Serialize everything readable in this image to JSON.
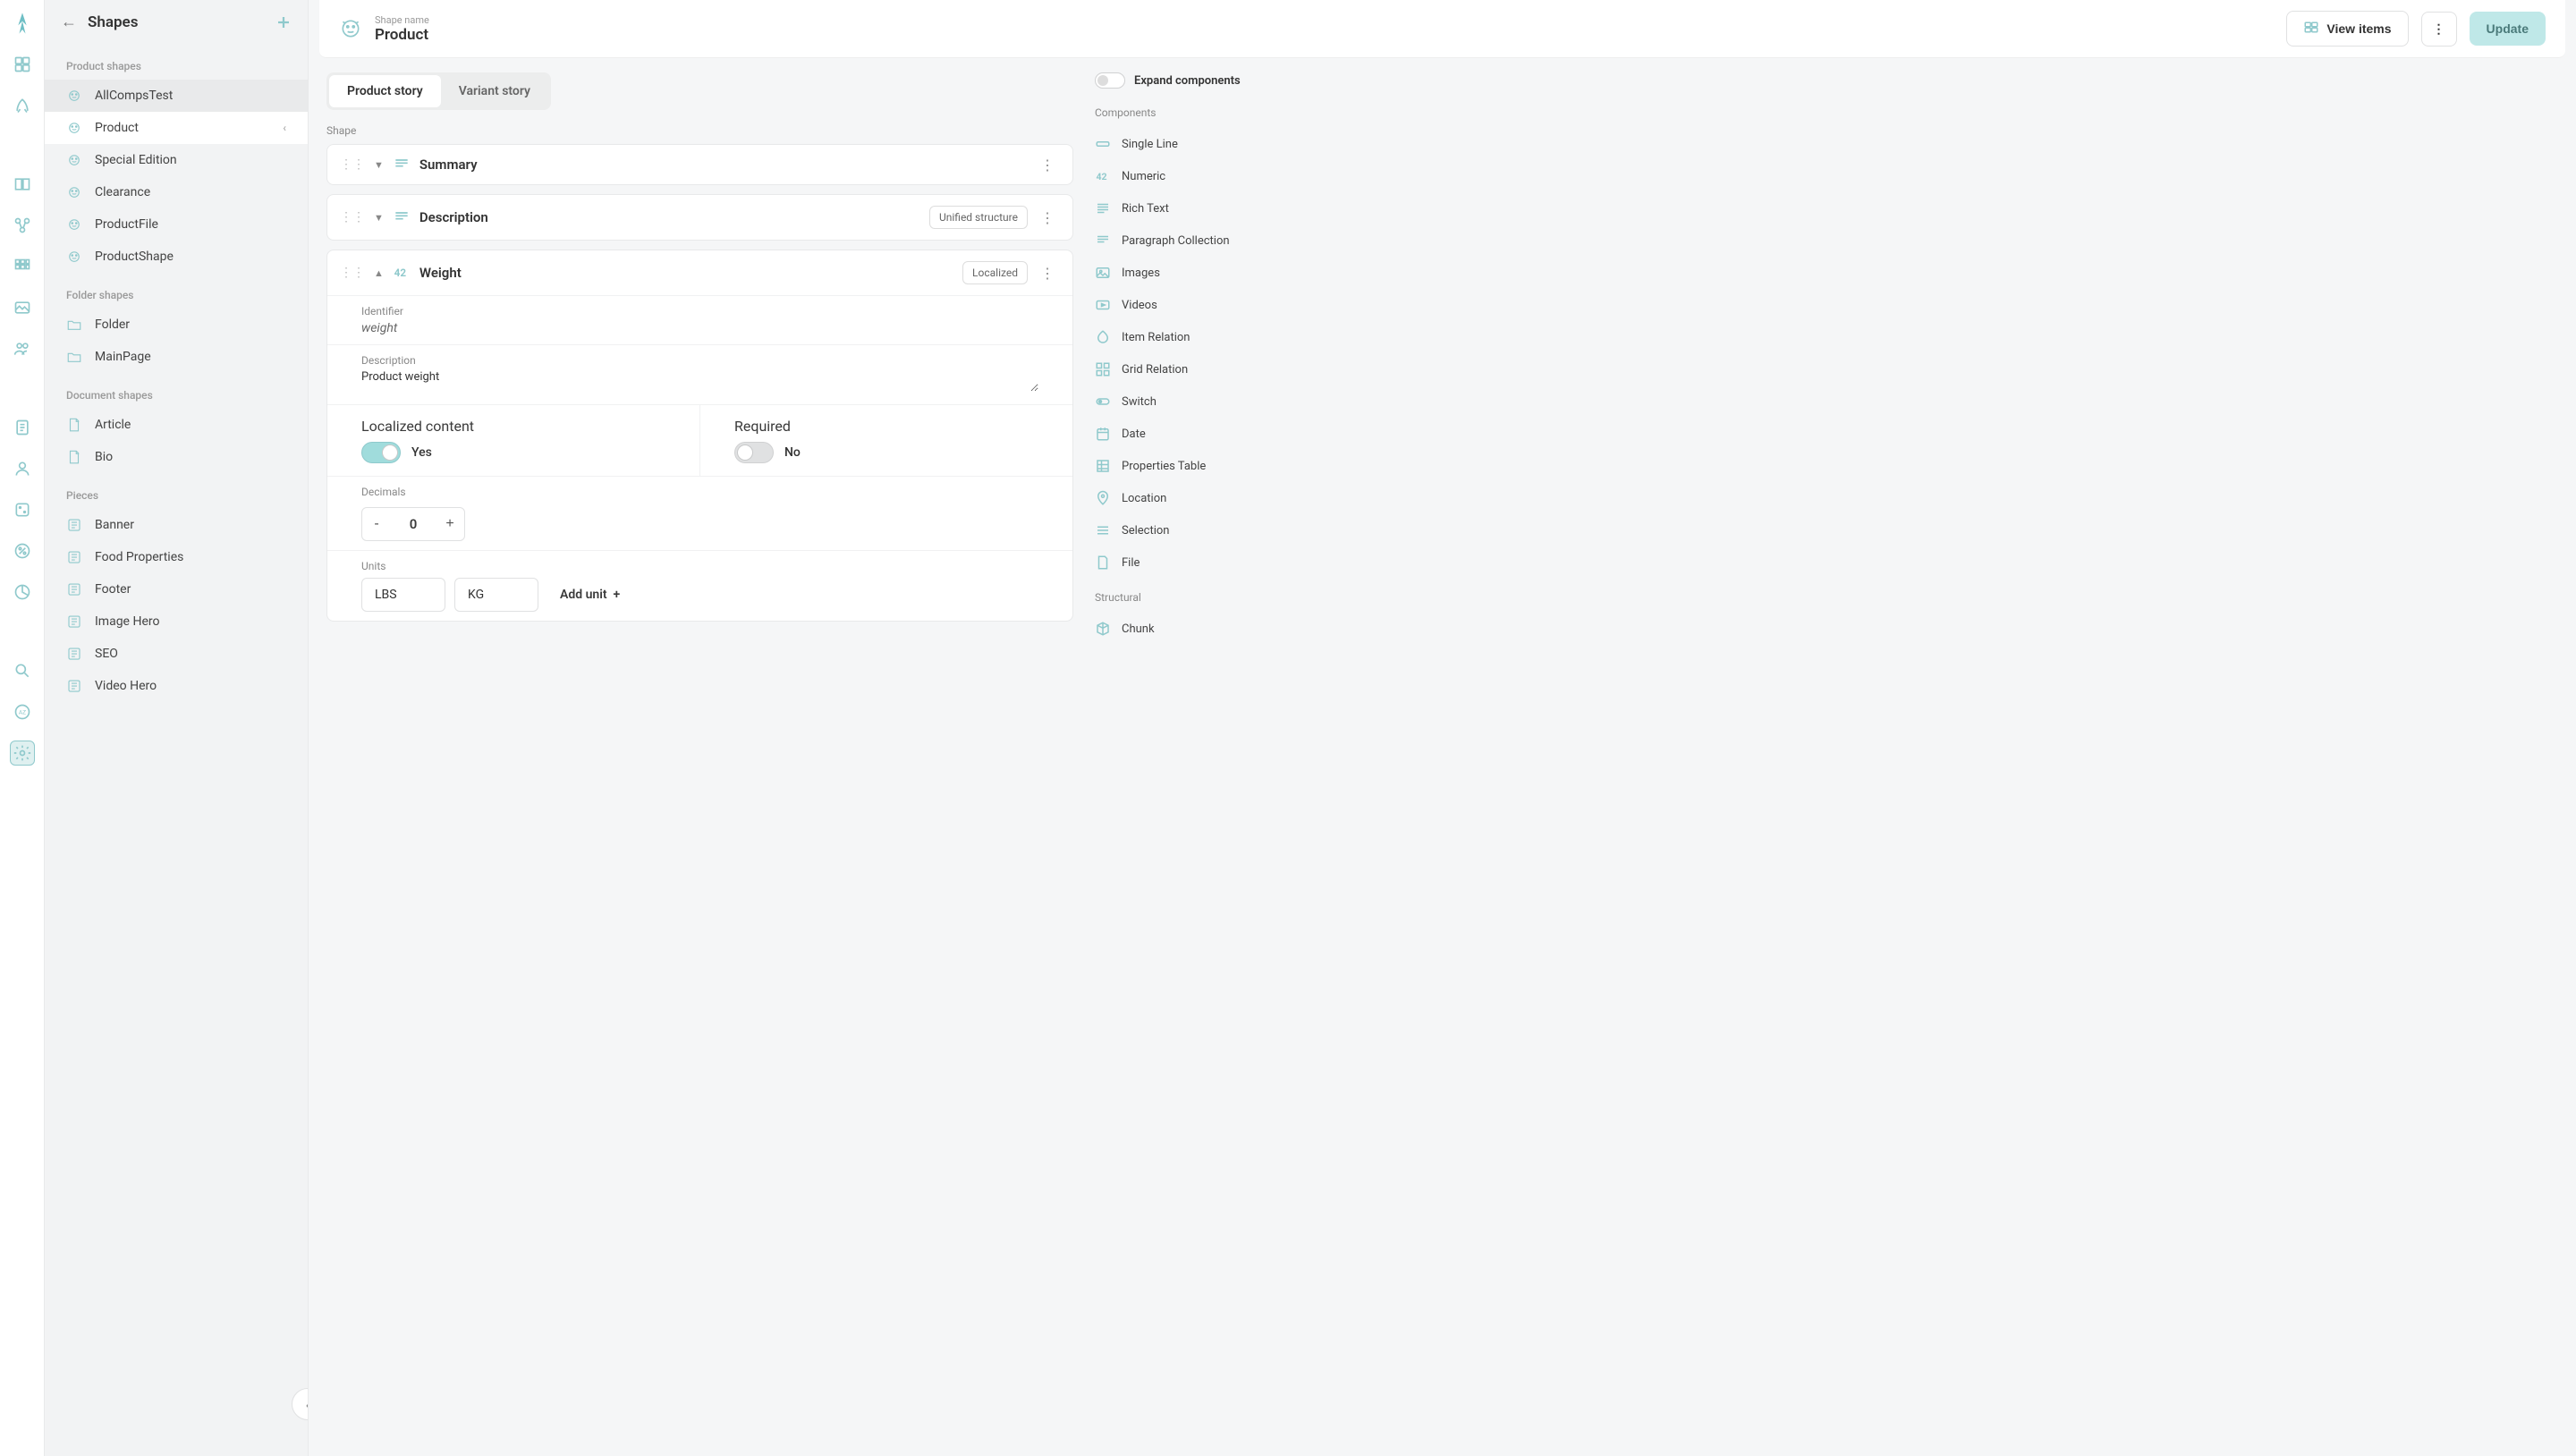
{
  "rail": [
    "logo",
    "catalogue",
    "rocket",
    "book",
    "shapes",
    "grid",
    "image",
    "people",
    "doc",
    "users",
    "dice",
    "percent",
    "piechart",
    "search",
    "az",
    "gear"
  ],
  "sidebar": {
    "title": "Shapes",
    "groups": [
      {
        "name": "Product shapes",
        "items": [
          {
            "label": "AllCompsTest",
            "iconName": "product-shape-icon"
          },
          {
            "label": "Product",
            "active": true,
            "iconName": "product-shape-icon"
          },
          {
            "label": "Special Edition",
            "iconName": "product-shape-icon"
          },
          {
            "label": "Clearance",
            "iconName": "product-shape-icon"
          },
          {
            "label": "ProductFile",
            "iconName": "product-shape-icon"
          },
          {
            "label": "ProductShape",
            "iconName": "product-shape-icon"
          }
        ]
      },
      {
        "name": "Folder shapes",
        "items": [
          {
            "label": "Folder",
            "iconName": "folder-icon"
          },
          {
            "label": "MainPage",
            "iconName": "folder-icon"
          }
        ]
      },
      {
        "name": "Document shapes",
        "items": [
          {
            "label": "Article",
            "iconName": "document-icon"
          },
          {
            "label": "Bio",
            "iconName": "document-icon"
          }
        ]
      },
      {
        "name": "Pieces",
        "items": [
          {
            "label": "Banner",
            "iconName": "piece-icon"
          },
          {
            "label": "Food Properties",
            "iconName": "piece-icon"
          },
          {
            "label": "Footer",
            "iconName": "piece-icon"
          },
          {
            "label": "Image Hero",
            "iconName": "piece-icon"
          },
          {
            "label": "SEO",
            "iconName": "piece-icon"
          },
          {
            "label": "Video Hero",
            "iconName": "piece-icon"
          }
        ]
      }
    ]
  },
  "header": {
    "label": "Shape name",
    "value": "Product",
    "view_items": "View items",
    "update": "Update"
  },
  "tabs": [
    {
      "label": "Product story",
      "active": true
    },
    {
      "label": "Variant story"
    }
  ],
  "shape_section_label": "Shape",
  "components": [
    {
      "name": "Summary",
      "type": "richtext",
      "collapsed": true,
      "iconName": "paragraph-icon"
    },
    {
      "name": "Description",
      "type": "richtext",
      "collapsed": true,
      "badge": "Unified structure",
      "iconName": "paragraph-icon"
    },
    {
      "name": "Weight",
      "type": "numeric",
      "collapsed": false,
      "badge": "Localized",
      "iconName": "numeric-icon",
      "identifier_label": "Identifier",
      "identifier_value": "weight",
      "description_label": "Description",
      "description_value": "Product weight",
      "localized_label": "Localized content",
      "localized_value": "Yes",
      "required_label": "Required",
      "required_value": "No",
      "decimals_label": "Decimals",
      "decimals_value": "0",
      "units_label": "Units",
      "units": [
        "LBS",
        "KG"
      ],
      "add_unit_label": "Add unit"
    }
  ],
  "right": {
    "expand_label": "Expand components",
    "components_header": "Components",
    "component_types": [
      {
        "label": "Single Line",
        "iconName": "singleline-icon"
      },
      {
        "label": "Numeric",
        "iconName": "numeric-icon"
      },
      {
        "label": "Rich Text",
        "iconName": "richtext-icon"
      },
      {
        "label": "Paragraph Collection",
        "iconName": "paragraph-icon"
      },
      {
        "label": "Images",
        "iconName": "images-icon"
      },
      {
        "label": "Videos",
        "iconName": "videos-icon"
      },
      {
        "label": "Item Relation",
        "iconName": "itemrelation-icon"
      },
      {
        "label": "Grid Relation",
        "iconName": "gridrelation-icon"
      },
      {
        "label": "Switch",
        "iconName": "switch-icon"
      },
      {
        "label": "Date",
        "iconName": "date-icon"
      },
      {
        "label": "Properties Table",
        "iconName": "propertiestable-icon"
      },
      {
        "label": "Location",
        "iconName": "location-icon"
      },
      {
        "label": "Selection",
        "iconName": "selection-icon"
      },
      {
        "label": "File",
        "iconName": "file-icon"
      }
    ],
    "structural_header": "Structural",
    "structural_types": [
      {
        "label": "Chunk",
        "iconName": "chunk-icon"
      }
    ]
  }
}
